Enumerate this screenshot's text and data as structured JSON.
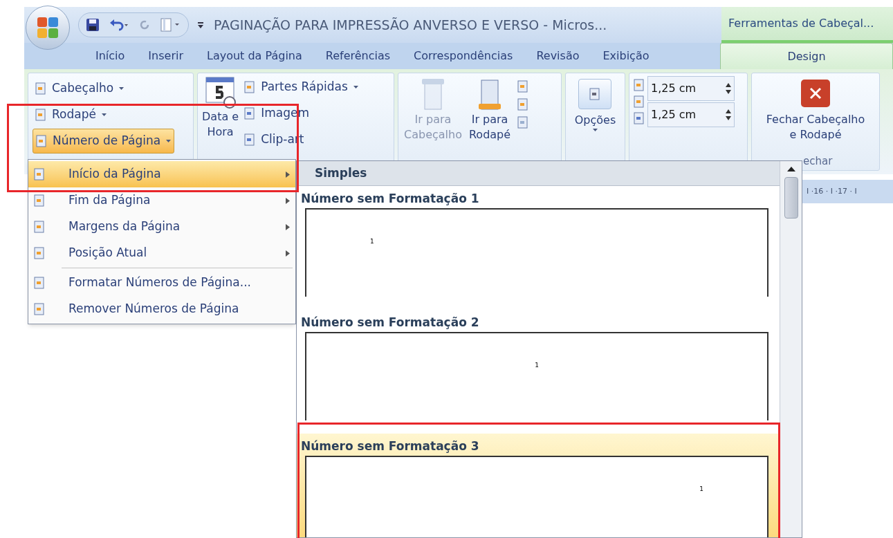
{
  "title_bar": {
    "title": "PAGINAÇÃO PARA IMPRESSÃO ANVERSO E VERSO - Micros...",
    "context_group": "Ferramentas de Cabeçal..."
  },
  "ribbon_tabs": [
    {
      "label": "Início",
      "selected": false,
      "contextual": false
    },
    {
      "label": "Inserir",
      "selected": false,
      "contextual": false
    },
    {
      "label": "Layout da Página",
      "selected": false,
      "contextual": false
    },
    {
      "label": "Referências",
      "selected": false,
      "contextual": false
    },
    {
      "label": "Correspondências",
      "selected": false,
      "contextual": false
    },
    {
      "label": "Revisão",
      "selected": false,
      "contextual": false
    },
    {
      "label": "Exibição",
      "selected": false,
      "contextual": false
    },
    {
      "label": "Design",
      "selected": true,
      "contextual": true
    }
  ],
  "ribbon": {
    "header_footer": [
      {
        "label": "Cabeçalho",
        "selected": false
      },
      {
        "label": "Rodapé",
        "selected": false
      },
      {
        "label": "Número de Página",
        "selected": true
      }
    ],
    "date_time": [
      "Data e",
      "Hora"
    ],
    "insert": [
      {
        "label": "Partes Rápidas",
        "dropdown": true
      },
      {
        "label": "Imagem",
        "dropdown": false
      },
      {
        "label": "Clip-art",
        "dropdown": false
      }
    ],
    "navigation": [
      {
        "label": [
          "Ir para",
          "Cabeçalho"
        ],
        "disabled": true
      },
      {
        "label": [
          "Ir para",
          "Rodapé"
        ],
        "disabled": false
      }
    ],
    "options": "Opções",
    "position": [
      {
        "value": "1,25 cm"
      },
      {
        "value": "1,25 cm"
      }
    ],
    "close": [
      "Fechar Cabeçalho",
      "e Rodapé"
    ],
    "close_group_label": "echar"
  },
  "page_number_menu": [
    {
      "label": "Início da Página",
      "kind": "submenu",
      "selected": true
    },
    {
      "label": "Fim da Página",
      "kind": "submenu",
      "selected": false
    },
    {
      "label": "Margens da Página",
      "kind": "submenu",
      "selected": false
    },
    {
      "label": "Posição Atual",
      "kind": "submenu",
      "selected": false
    },
    {
      "label": "Formatar Números de Página...",
      "kind": "command",
      "selected": false
    },
    {
      "label": "Remover Números de Página",
      "kind": "command",
      "selected": false
    }
  ],
  "gallery": {
    "category": "Simples",
    "items": [
      {
        "title": "Número sem Formatação 1",
        "number": "1",
        "kind": "left",
        "selected": false
      },
      {
        "title": "Número sem Formatação 2",
        "number": "1",
        "kind": "center",
        "selected": false
      },
      {
        "title": "Número sem Formatação 3",
        "number": "1",
        "kind": "right",
        "selected": true
      }
    ]
  },
  "ruler": "I ·16 · I ·17 · I"
}
